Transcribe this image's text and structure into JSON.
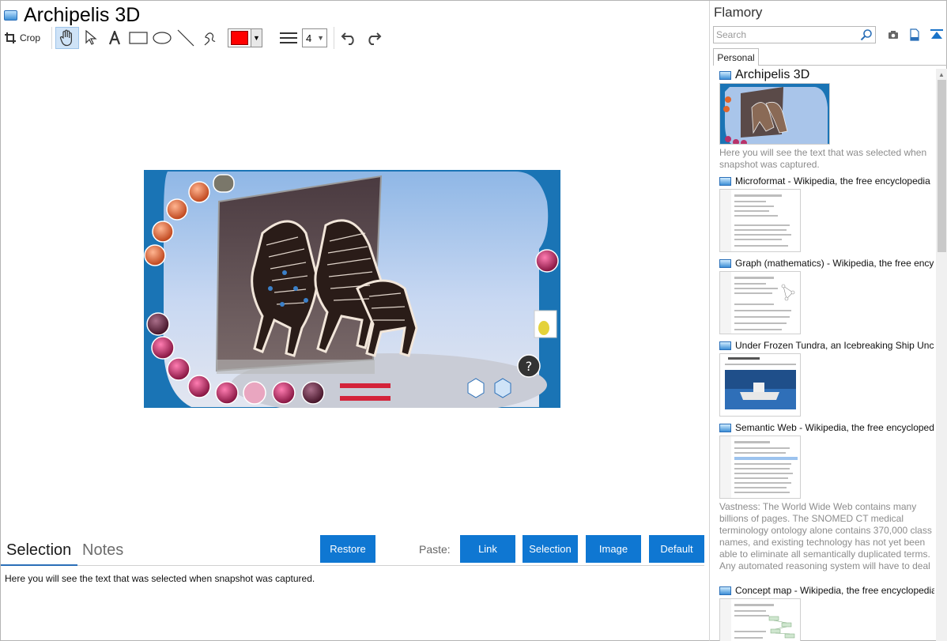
{
  "window": {
    "title": "Archipelis 3D"
  },
  "toolbar": {
    "crop_label": "Crop",
    "tools": [
      "hand-icon",
      "pointer-icon",
      "text-icon",
      "rectangle-icon",
      "ellipse-icon",
      "line-icon",
      "freehand-icon"
    ],
    "color": "#ff0000",
    "line_width": "4"
  },
  "bottom": {
    "tabs": {
      "selection": "Selection",
      "notes": "Notes"
    },
    "restore_label": "Restore",
    "paste_label": "Paste:",
    "paste_buttons": {
      "link": "Link",
      "selection": "Selection",
      "image": "Image",
      "default": "Default"
    },
    "selection_text": "Here you will see the text that was selected when snapshot was captured."
  },
  "sidebar": {
    "app_name": "Flamory",
    "search_placeholder": "Search",
    "tab": "Personal",
    "items": [
      {
        "title": "Archipelis 3D",
        "desc": "Here you will see the text that was selected when snapshot was captured."
      },
      {
        "title": "Microformat - Wikipedia, the free encyclopedia",
        "desc": ""
      },
      {
        "title": "Graph (mathematics) - Wikipedia, the free ency",
        "desc": ""
      },
      {
        "title": "Under Frozen Tundra, an Icebreaking Ship Unco",
        "desc": ""
      },
      {
        "title": "Semantic Web - Wikipedia, the free encycloped",
        "desc": "Vastness: The World Wide Web contains many billions of pages. The SNOMED CT medical terminology ontology alone contains 370,000 class names, and existing technology has not yet been able to eliminate all semantically duplicated terms. Any automated reasoning system will have to deal with truly huge inputs."
      },
      {
        "title": "Concept map - Wikipedia, the free encyclopedia",
        "desc": ""
      }
    ]
  },
  "colors": {
    "accent": "#0f77d2",
    "tab_underline": "#2a6fb8"
  }
}
